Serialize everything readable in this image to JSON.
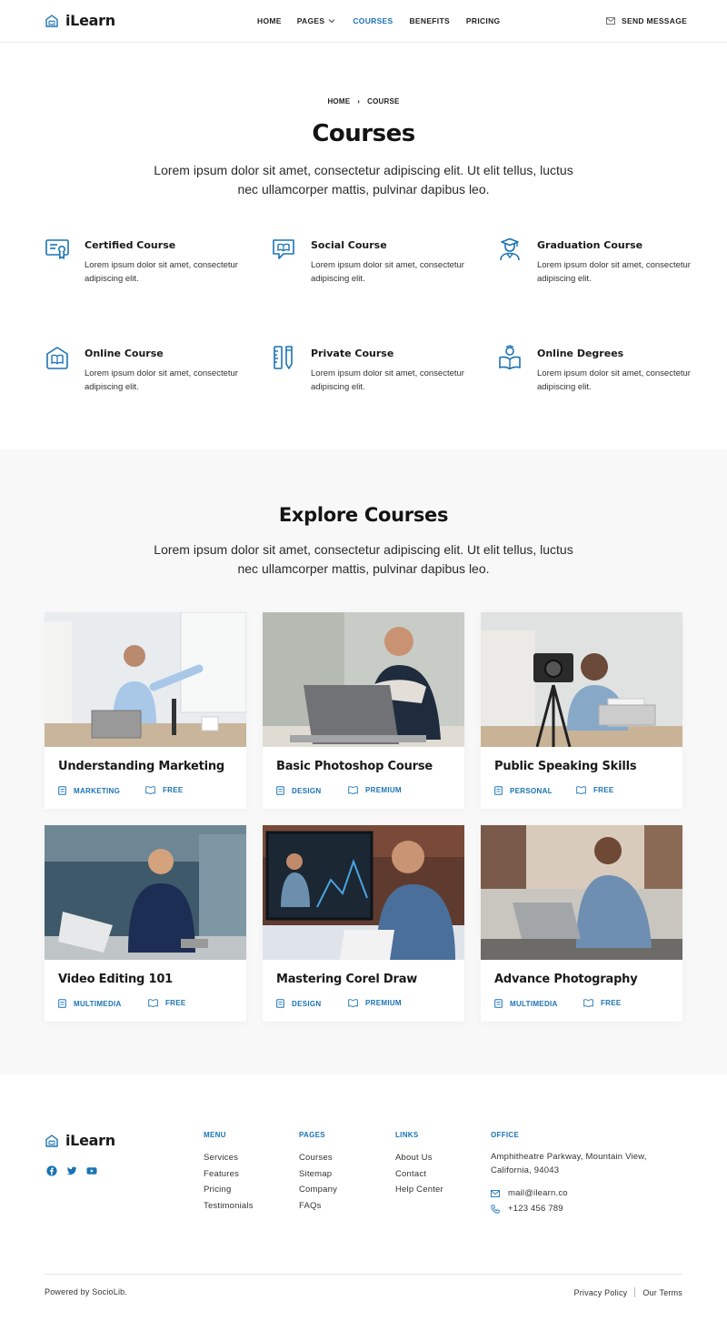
{
  "brand": {
    "name": "iLearn",
    "accent": "#1a73b5"
  },
  "nav": {
    "items": [
      {
        "label": "HOME"
      },
      {
        "label": "PAGES"
      },
      {
        "label": "COURSES"
      },
      {
        "label": "BENEFITS"
      },
      {
        "label": "PRICING"
      }
    ],
    "send_message": "SEND MESSAGE"
  },
  "hero": {
    "breadcrumb": [
      "HOME",
      "COURSE"
    ],
    "title": "Courses",
    "subtitle": "Lorem ipsum dolor sit amet, consectetur adipiscing elit. Ut elit tellus, luctus nec ullamcorper mattis, pulvinar dapibus leo."
  },
  "features": [
    {
      "title": "Certified Course",
      "desc": "Lorem ipsum dolor sit amet, consectetur adipiscing elit.",
      "icon": "certificate-icon"
    },
    {
      "title": "Social Course",
      "desc": "Lorem ipsum dolor sit amet, consectetur adipiscing elit.",
      "icon": "chat-book-icon"
    },
    {
      "title": "Graduation Course",
      "desc": "Lorem ipsum dolor sit amet, consectetur adipiscing elit.",
      "icon": "graduate-icon"
    },
    {
      "title": "Online Course",
      "desc": "Lorem ipsum dolor sit amet, consectetur adipiscing elit.",
      "icon": "home-book-icon"
    },
    {
      "title": "Private Course",
      "desc": "Lorem ipsum dolor sit amet, consectetur adipiscing elit.",
      "icon": "ruler-pencil-icon"
    },
    {
      "title": "Online Degrees",
      "desc": "Lorem ipsum dolor sit amet, consectetur adipiscing elit.",
      "icon": "reader-icon"
    }
  ],
  "explore": {
    "title": "Explore Courses",
    "subtitle": "Lorem ipsum dolor sit amet, consectetur adipiscing elit. Ut elit tellus, luctus nec ullamcorper mattis, pulvinar dapibus leo.",
    "courses": [
      {
        "title": "Understanding Marketing",
        "category": "MARKETING",
        "price": "FREE"
      },
      {
        "title": "Basic Photoshop Course",
        "category": "DESIGN",
        "price": "PREMIUM"
      },
      {
        "title": "Public Speaking Skills",
        "category": "PERSONAL",
        "price": "FREE"
      },
      {
        "title": "Video Editing 101",
        "category": "MULTIMEDIA",
        "price": "FREE"
      },
      {
        "title": "Mastering Corel Draw",
        "category": "DESIGN",
        "price": "PREMIUM"
      },
      {
        "title": "Advance Photography",
        "category": "MULTIMEDIA",
        "price": "FREE"
      }
    ]
  },
  "footer": {
    "brand": "iLearn",
    "menu": {
      "title": "MENU",
      "links": [
        "Services",
        "Features",
        "Pricing",
        "Testimonials"
      ]
    },
    "pages": {
      "title": "PAGES",
      "links": [
        "Courses",
        "Sitemap",
        "Company",
        "FAQs"
      ]
    },
    "links": {
      "title": "LINKS",
      "links": [
        "About Us",
        "Contact",
        "Help Center"
      ]
    },
    "office": {
      "title": "OFFICE",
      "address": "Amphitheatre Parkway, Mountain View, California, 94043",
      "email": "mail@ilearn.co",
      "phone": "+123 456 789"
    },
    "powered": "Powered by SocioLib.",
    "privacy": "Privacy Policy",
    "terms": "Our Terms"
  }
}
